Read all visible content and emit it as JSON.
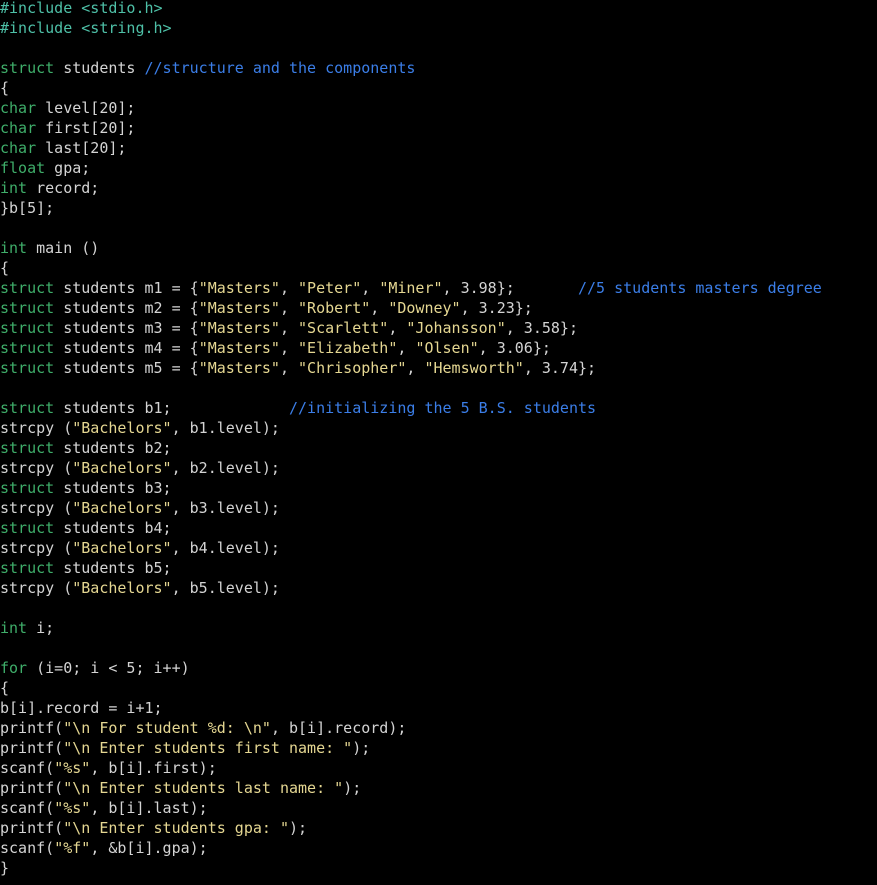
{
  "editor": {
    "background": "#000000",
    "colors": {
      "default": "#d4d4d4",
      "prep": "#4ec0a7",
      "kw": "#3fae6a",
      "str": "#e5d792",
      "cmt": "#3b7ee8"
    },
    "lines": [
      [
        [
          "prep",
          "#include <stdio.h>"
        ]
      ],
      [
        [
          "prep",
          "#include <string.h>"
        ]
      ],
      [],
      [
        [
          "kw",
          "struct"
        ],
        [
          "default",
          " students "
        ],
        [
          "cmt",
          "//structure and the components"
        ]
      ],
      [
        [
          "default",
          "{"
        ]
      ],
      [
        [
          "kw",
          "char"
        ],
        [
          "default",
          " level[20];"
        ]
      ],
      [
        [
          "kw",
          "char"
        ],
        [
          "default",
          " first[20];"
        ]
      ],
      [
        [
          "kw",
          "char"
        ],
        [
          "default",
          " last[20];"
        ]
      ],
      [
        [
          "kw",
          "float"
        ],
        [
          "default",
          " gpa;"
        ]
      ],
      [
        [
          "kw",
          "int"
        ],
        [
          "default",
          " record;"
        ]
      ],
      [
        [
          "default",
          "}b[5];"
        ]
      ],
      [],
      [
        [
          "kw",
          "int"
        ],
        [
          "default",
          " main ()"
        ]
      ],
      [
        [
          "default",
          "{"
        ]
      ],
      [
        [
          "kw",
          "struct"
        ],
        [
          "default",
          " students m1 = {"
        ],
        [
          "str",
          "\"Masters\""
        ],
        [
          "default",
          ", "
        ],
        [
          "str",
          "\"Peter\""
        ],
        [
          "default",
          ", "
        ],
        [
          "str",
          "\"Miner\""
        ],
        [
          "default",
          ", 3.98};       "
        ],
        [
          "cmt",
          "//5 students masters degree"
        ]
      ],
      [
        [
          "kw",
          "struct"
        ],
        [
          "default",
          " students m2 = {"
        ],
        [
          "str",
          "\"Masters\""
        ],
        [
          "default",
          ", "
        ],
        [
          "str",
          "\"Robert\""
        ],
        [
          "default",
          ", "
        ],
        [
          "str",
          "\"Downey\""
        ],
        [
          "default",
          ", 3.23};"
        ]
      ],
      [
        [
          "kw",
          "struct"
        ],
        [
          "default",
          " students m3 = {"
        ],
        [
          "str",
          "\"Masters\""
        ],
        [
          "default",
          ", "
        ],
        [
          "str",
          "\"Scarlett\""
        ],
        [
          "default",
          ", "
        ],
        [
          "str",
          "\"Johansson\""
        ],
        [
          "default",
          ", 3.58};"
        ]
      ],
      [
        [
          "kw",
          "struct"
        ],
        [
          "default",
          " students m4 = {"
        ],
        [
          "str",
          "\"Masters\""
        ],
        [
          "default",
          ", "
        ],
        [
          "str",
          "\"Elizabeth\""
        ],
        [
          "default",
          ", "
        ],
        [
          "str",
          "\"Olsen\""
        ],
        [
          "default",
          ", 3.06};"
        ]
      ],
      [
        [
          "kw",
          "struct"
        ],
        [
          "default",
          " students m5 = {"
        ],
        [
          "str",
          "\"Masters\""
        ],
        [
          "default",
          ", "
        ],
        [
          "str",
          "\"Chrisopher\""
        ],
        [
          "default",
          ", "
        ],
        [
          "str",
          "\"Hemsworth\""
        ],
        [
          "default",
          ", 3.74};"
        ]
      ],
      [],
      [
        [
          "kw",
          "struct"
        ],
        [
          "default",
          " students b1;             "
        ],
        [
          "cmt",
          "//initializing the 5 B.S. students"
        ]
      ],
      [
        [
          "default",
          "strcpy ("
        ],
        [
          "str",
          "\"Bachelors\""
        ],
        [
          "default",
          ", b1.level);"
        ]
      ],
      [
        [
          "kw",
          "struct"
        ],
        [
          "default",
          " students b2;"
        ]
      ],
      [
        [
          "default",
          "strcpy ("
        ],
        [
          "str",
          "\"Bachelors\""
        ],
        [
          "default",
          ", b2.level);"
        ]
      ],
      [
        [
          "kw",
          "struct"
        ],
        [
          "default",
          " students b3;"
        ]
      ],
      [
        [
          "default",
          "strcpy ("
        ],
        [
          "str",
          "\"Bachelors\""
        ],
        [
          "default",
          ", b3.level);"
        ]
      ],
      [
        [
          "kw",
          "struct"
        ],
        [
          "default",
          " students b4;"
        ]
      ],
      [
        [
          "default",
          "strcpy ("
        ],
        [
          "str",
          "\"Bachelors\""
        ],
        [
          "default",
          ", b4.level);"
        ]
      ],
      [
        [
          "kw",
          "struct"
        ],
        [
          "default",
          " students b5;"
        ]
      ],
      [
        [
          "default",
          "strcpy ("
        ],
        [
          "str",
          "\"Bachelors\""
        ],
        [
          "default",
          ", b5.level);"
        ]
      ],
      [],
      [
        [
          "kw",
          "int"
        ],
        [
          "default",
          " i;"
        ]
      ],
      [],
      [
        [
          "kw",
          "for"
        ],
        [
          "default",
          " (i=0; i < 5; i++)"
        ]
      ],
      [
        [
          "default",
          "{"
        ]
      ],
      [
        [
          "default",
          "b[i].record = i+1;"
        ]
      ],
      [
        [
          "default",
          "printf("
        ],
        [
          "str",
          "\"\\n For student %d: \\n\""
        ],
        [
          "default",
          ", b[i].record);"
        ]
      ],
      [
        [
          "default",
          "printf("
        ],
        [
          "str",
          "\"\\n Enter students first name: \""
        ],
        [
          "default",
          ");"
        ]
      ],
      [
        [
          "default",
          "scanf("
        ],
        [
          "str",
          "\"%s\""
        ],
        [
          "default",
          ", b[i].first);"
        ]
      ],
      [
        [
          "default",
          "printf("
        ],
        [
          "str",
          "\"\\n Enter students last name: \""
        ],
        [
          "default",
          ");"
        ]
      ],
      [
        [
          "default",
          "scanf("
        ],
        [
          "str",
          "\"%s\""
        ],
        [
          "default",
          ", b[i].last);"
        ]
      ],
      [
        [
          "default",
          "printf("
        ],
        [
          "str",
          "\"\\n Enter students gpa: \""
        ],
        [
          "default",
          ");"
        ]
      ],
      [
        [
          "default",
          "scanf("
        ],
        [
          "str",
          "\"%f\""
        ],
        [
          "default",
          ", &b[i].gpa);"
        ]
      ],
      [
        [
          "default",
          "}"
        ]
      ]
    ]
  }
}
